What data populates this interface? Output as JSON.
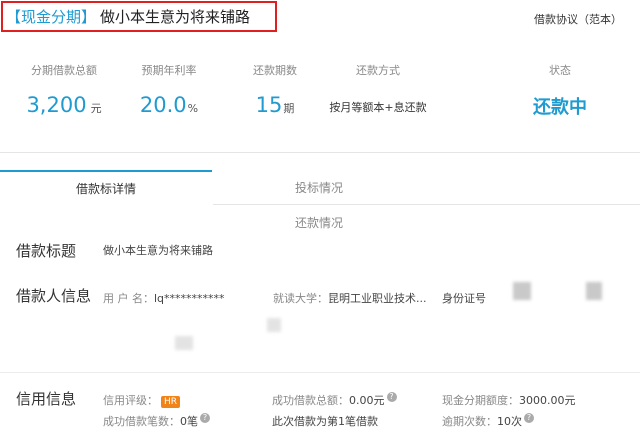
{
  "header": {
    "tag": "【现金分期】",
    "title": "做小本生意为将来铺路",
    "agreement_link": "借款协议（范本）"
  },
  "stats": [
    {
      "label": "分期借款总额",
      "value": "3,200",
      "unit": "元"
    },
    {
      "label": "预期年利率",
      "value": "20.0",
      "unit": "%"
    },
    {
      "label": "还款期数",
      "value": "15",
      "unit": "期"
    },
    {
      "label": "还款方式",
      "value": "按月等额本+息还款"
    },
    {
      "label": "状态",
      "value": "还款中"
    }
  ],
  "tabs": {
    "active": "借款标详情",
    "second": "投标情况",
    "third": "还款情况"
  },
  "loan_title": {
    "label": "借款标题",
    "value": "做小本生意为将来铺路"
  },
  "borrower": {
    "label": "借款人信息",
    "username_label": "用 户 名：",
    "username_value": "lq***********",
    "university_label": "就读大学：",
    "university_value": "昆明工业职业技术...",
    "id_label": "身份证号"
  },
  "credit": {
    "label": "信用信息",
    "rating_label": "信用评级：",
    "rating_value": "HR",
    "success_total_label": "成功借款总额：",
    "success_total_value": "0.00元",
    "limit_label": "现金分期额度：",
    "limit_value": "3000.00元",
    "success_count_label": "成功借款笔数：",
    "success_count_value": "0笔",
    "this_loan_text": "此次借款为第1笔借款",
    "overdue_label": "逾期次数：",
    "overdue_value": "10次"
  },
  "colors": {
    "accent": "#1f9bd1",
    "highlight_border": "#e02020",
    "badge": "#f08418"
  }
}
